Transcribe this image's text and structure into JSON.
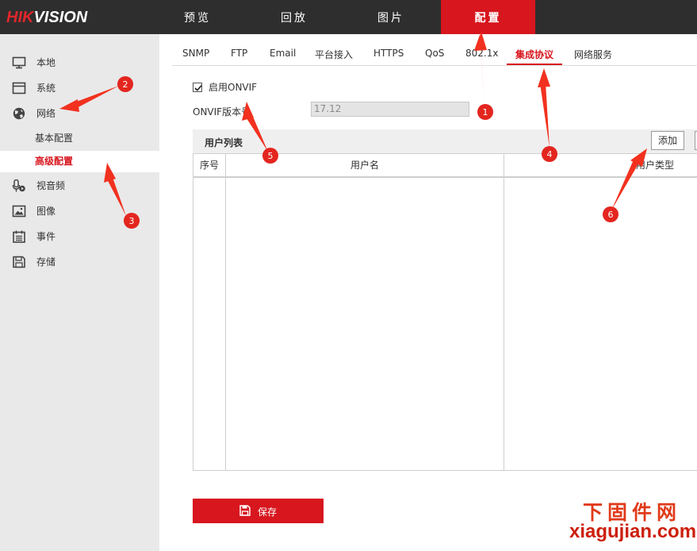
{
  "brand": {
    "logo_red": "HIK",
    "logo_white": "VISION"
  },
  "top_nav": [
    {
      "label": "预览"
    },
    {
      "label": "回放"
    },
    {
      "label": "图片"
    },
    {
      "label": "配置",
      "active": true
    }
  ],
  "sidebar": {
    "items": [
      {
        "label": "本地",
        "icon": "monitor-icon"
      },
      {
        "label": "系统",
        "icon": "system-icon"
      },
      {
        "label": "网络",
        "icon": "globe-icon"
      },
      {
        "label": "视音频",
        "icon": "microphone-icon"
      },
      {
        "label": "图像",
        "icon": "image-icon"
      },
      {
        "label": "事件",
        "icon": "calendar-icon"
      },
      {
        "label": "存储",
        "icon": "floppy-icon"
      }
    ],
    "sub_items": [
      {
        "label": "基本配置",
        "active": false
      },
      {
        "label": "高级配置",
        "active": true
      }
    ]
  },
  "tabs": [
    {
      "label": "SNMP"
    },
    {
      "label": "FTP"
    },
    {
      "label": "Email"
    },
    {
      "label": "平台接入"
    },
    {
      "label": "HTTPS"
    },
    {
      "label": "QoS"
    },
    {
      "label": "802.1x"
    },
    {
      "label": "集成协议",
      "active": true
    },
    {
      "label": "网络服务"
    }
  ],
  "onvif": {
    "enable_label": "启用ONVIF",
    "enabled": true,
    "version_label": "ONVIF版本号",
    "version_value": "17.12"
  },
  "user_list": {
    "title": "用户列表",
    "add_label": "添加",
    "columns": [
      "序号",
      "用户名",
      "用户类型"
    ]
  },
  "save_label": "保存",
  "watermark": {
    "cn": "下固件网",
    "en": "xiagujian.com"
  },
  "annotations": [
    "1",
    "2",
    "3",
    "4",
    "5",
    "6"
  ],
  "colors": {
    "accent": "#d7161e",
    "topbar": "#2e2e2e",
    "sidebar": "#e9e9e9",
    "arrow": "#f2311f"
  }
}
